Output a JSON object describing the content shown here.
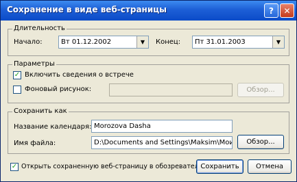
{
  "title": "Сохранение в виде веб-страницы",
  "icons": {
    "help": "help-icon",
    "close": "close-icon",
    "dropdown": "dropdown-arrow-icon"
  },
  "duration": {
    "legend": "Длительность",
    "start_label": "Начало:",
    "start_value": "Вт 01.12.2002",
    "end_label": "Конец:",
    "end_value": "Пт 31.01.2003"
  },
  "params": {
    "legend": "Параметры",
    "include_meetings_label": "Включить сведения о встрече",
    "include_meetings_checked": true,
    "background_label": "Фоновый рисунок:",
    "background_checked": false,
    "background_value": "",
    "browse_label": "Обзор..."
  },
  "save_as": {
    "legend": "Сохранить как",
    "calendar_name_label": "Название календаря:",
    "calendar_name_value": "Morozova Dasha",
    "file_name_label": "Имя файла:",
    "file_name_value": "D:\\Documents and Settings\\Maksim\\Мои докум",
    "browse_label": "Обзор..."
  },
  "open_in_browser_label": "Открыть сохраненную веб-страницу в обозревателе",
  "open_in_browser_checked": true,
  "save_button": "Сохранить",
  "cancel_button": "Отмена"
}
